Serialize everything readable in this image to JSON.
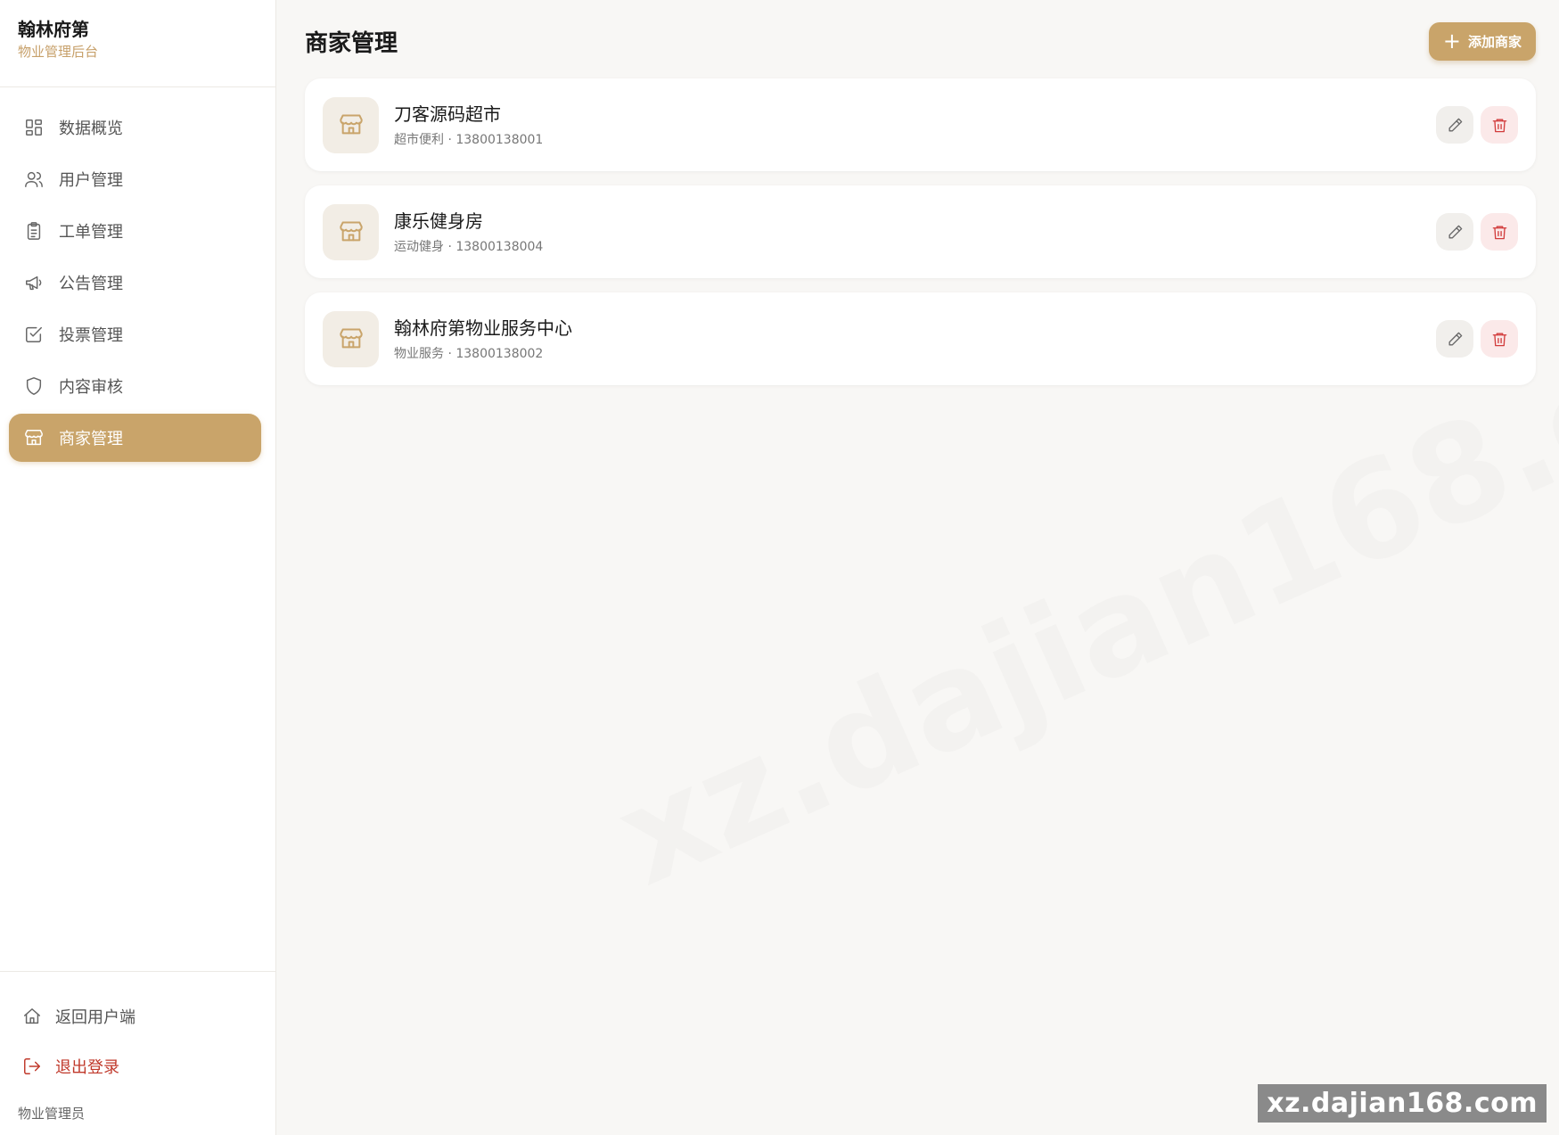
{
  "brand": {
    "title": "翰林府第",
    "subtitle": "物业管理后台"
  },
  "sidebar": {
    "items": [
      {
        "label": "数据概览",
        "icon": "grid-icon",
        "active": false
      },
      {
        "label": "用户管理",
        "icon": "users-icon",
        "active": false
      },
      {
        "label": "工单管理",
        "icon": "clipboard-icon",
        "active": false
      },
      {
        "label": "公告管理",
        "icon": "megaphone-icon",
        "active": false
      },
      {
        "label": "投票管理",
        "icon": "check-square-icon",
        "active": false
      },
      {
        "label": "内容审核",
        "icon": "shield-icon",
        "active": false
      },
      {
        "label": "商家管理",
        "icon": "store-icon",
        "active": true
      }
    ],
    "back_label": "返回用户端",
    "logout_label": "退出登录",
    "role": "物业管理员"
  },
  "main": {
    "title": "商家管理",
    "add_label": "添加商家",
    "merchants": [
      {
        "name": "刀客源码超市",
        "meta": "超市便利 · 13800138001"
      },
      {
        "name": "康乐健身房",
        "meta": "运动健身 · 13800138004"
      },
      {
        "name": "翰林府第物业服务中心",
        "meta": "物业服务 · 13800138002"
      }
    ]
  },
  "watermark": "xz.dajian168.com",
  "colors": {
    "accent": "#c9a46a",
    "danger": "#d23c3c",
    "background": "#f8f7f5"
  }
}
